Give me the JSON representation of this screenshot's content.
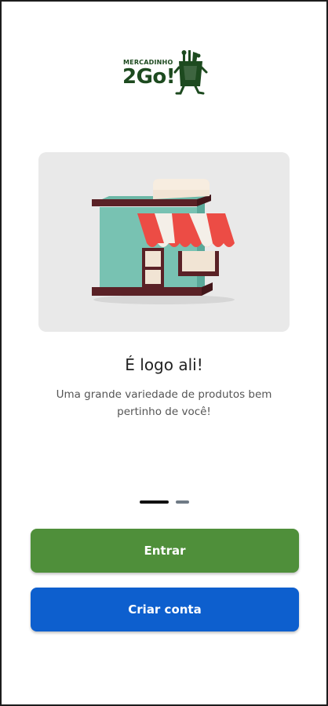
{
  "logo": {
    "line1": "MERCADINHO",
    "line2": "2Go!"
  },
  "onboarding": {
    "illustration_icon": "storefront-icon",
    "title": "É logo ali!",
    "description": "Uma grande variedade de produtos bem pertinho de você!",
    "current_page": 1,
    "total_pages": 2
  },
  "actions": {
    "login_label": "Entrar",
    "signup_label": "Criar conta"
  },
  "colors": {
    "brand_green": "#1d4a1f",
    "login_button": "#4f8f3a",
    "signup_button": "#0d5fce"
  }
}
